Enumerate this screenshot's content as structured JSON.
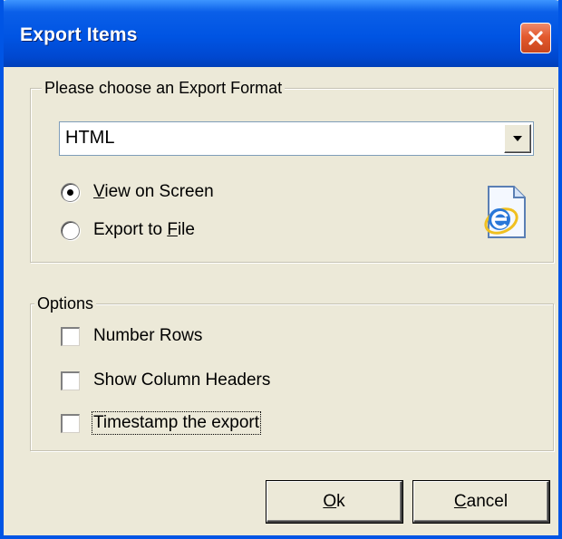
{
  "window": {
    "title": "Export Items",
    "close_icon": "close-icon"
  },
  "format_group": {
    "legend": "Please choose an Export Format",
    "format_select": {
      "value": "HTML",
      "arrow_icon": "chevron-down-icon"
    },
    "output_options": [
      {
        "mnemonic": "V",
        "rest": "iew on Screen",
        "label": "View on Screen",
        "selected": true
      },
      {
        "mnemonic": "",
        "rest": "",
        "label": "Export to File",
        "selected": false
      }
    ],
    "export_to_file": {
      "before": "Export to ",
      "mnemonic": "F",
      "after": "ile"
    },
    "format_icon": "internet-explorer-document-icon"
  },
  "options_group": {
    "legend": "Options",
    "items": [
      {
        "label": "Number Rows",
        "checked": false
      },
      {
        "label": "Show Column Headers",
        "checked": false
      },
      {
        "label": "Timestamp the export",
        "checked": false,
        "focused": true
      }
    ]
  },
  "buttons": {
    "ok": {
      "mnemonic": "O",
      "rest": "k",
      "label": "Ok"
    },
    "cancel": {
      "mnemonic": "C",
      "rest": "ancel",
      "label": "Cancel"
    }
  },
  "colors": {
    "titlebar": "#0054e3",
    "dialog_background": "#ece9d8",
    "close_button": "#e35a2e"
  }
}
